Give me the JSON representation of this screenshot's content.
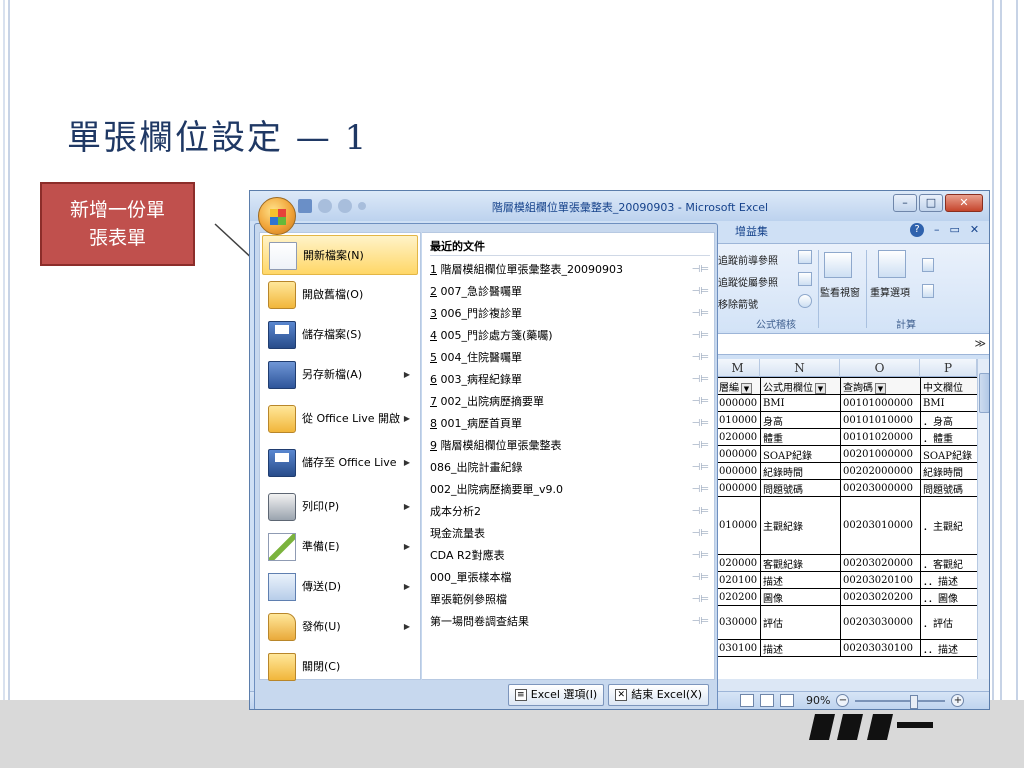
{
  "slide": {
    "title": "單張欄位設定 — 1",
    "callout": "新增一份單\n張表單"
  },
  "window": {
    "title": "階層模組欄位單張彙整表_20090903 - Microsoft Excel",
    "controls": [
      "minimize",
      "maximize",
      "close"
    ]
  },
  "ribbon": {
    "tab": "增益集",
    "help": "?",
    "items": [
      "追蹤前導參照",
      "追蹤從屬參照",
      "移除箭號",
      "監看視窗",
      "重算選項",
      "公式稽核",
      "計算"
    ]
  },
  "menu": {
    "commands": [
      {
        "label": "開新檔案(N)",
        "icon": "new-doc-icon",
        "has_sub": false,
        "highlight": true
      },
      {
        "label": "開啟舊檔(O)",
        "icon": "open-folder-icon",
        "has_sub": false
      },
      {
        "label": "儲存檔案(S)",
        "icon": "save-disk-icon",
        "has_sub": false
      },
      {
        "label": "另存新檔(A)",
        "icon": "save-as-icon",
        "has_sub": true
      },
      {
        "label": "從 Office Live 開啟",
        "icon": "open-live-icon",
        "has_sub": true
      },
      {
        "label": "儲存至 Office Live",
        "icon": "save-live-icon",
        "has_sub": true
      },
      {
        "label": "列印(P)",
        "icon": "printer-icon",
        "has_sub": true
      },
      {
        "label": "準備(E)",
        "icon": "prepare-icon",
        "has_sub": true
      },
      {
        "label": "傳送(D)",
        "icon": "send-icon",
        "has_sub": true
      },
      {
        "label": "發佈(U)",
        "icon": "publish-icon",
        "has_sub": true
      },
      {
        "label": "關閉(C)",
        "icon": "close-folder-icon",
        "has_sub": false
      }
    ],
    "recent_title": "最近的文件",
    "recent": [
      {
        "num": "1",
        "name": "階層模組欄位單張彙整表_20090903"
      },
      {
        "num": "2",
        "name": "007_急診醫囑單"
      },
      {
        "num": "3",
        "name": "006_門診複診單"
      },
      {
        "num": "4",
        "name": "005_門診處方箋(藥囑)"
      },
      {
        "num": "5",
        "name": "004_住院醫囑單"
      },
      {
        "num": "6",
        "name": "003_病程紀錄單"
      },
      {
        "num": "7",
        "name": "002_出院病歷摘要單"
      },
      {
        "num": "8",
        "name": "001_病歷首頁單"
      },
      {
        "num": "9",
        "name": "階層模組欄位單張彙整表"
      },
      {
        "num": "",
        "name": "086_出院計畫紀錄"
      },
      {
        "num": "",
        "name": "002_出院病歷摘要單_v9.0"
      },
      {
        "num": "",
        "name": "成本分析2"
      },
      {
        "num": "",
        "name": "現金流量表"
      },
      {
        "num": "",
        "name": "CDA R2對應表"
      },
      {
        "num": "",
        "name": "000_單張樣本檔"
      },
      {
        "num": "",
        "name": "單張範例參照檔"
      },
      {
        "num": "",
        "name": "第一場問卷調查結果"
      }
    ],
    "pin_glyph": "⊣⊨",
    "options_button": "Excel 選項(I)",
    "exit_button": "結束 Excel(X)"
  },
  "sheet": {
    "columns": [
      "M",
      "N",
      "O",
      "P"
    ],
    "header_row": [
      "層編",
      "公式用欄位",
      "查詢碼",
      "中文欄位"
    ],
    "rows": [
      {
        "m": "000000",
        "n": "BMI",
        "o": "00101000000",
        "p": "BMI",
        "kind": "normal"
      },
      {
        "m": "010000",
        "n": "身高",
        "o": "00101010000",
        "p": "．身高",
        "kind": "normal"
      },
      {
        "m": "020000",
        "n": "體重",
        "o": "00101020000",
        "p": "．體重",
        "kind": "normal"
      },
      {
        "m": "000000",
        "n": "SOAP紀錄",
        "o": "00201000000",
        "p": "SOAP紀錄",
        "kind": "normal"
      },
      {
        "m": "000000",
        "n": "紀錄時間",
        "o": "00202000000",
        "p": "紀錄時間",
        "kind": "normal"
      },
      {
        "m": "000000",
        "n": "問題號碼",
        "o": "00203000000",
        "p": "問題號碼",
        "kind": "normal"
      },
      {
        "m": "010000",
        "n": "主觀紀錄",
        "o": "00203010000",
        "p": "．主觀紀",
        "kind": "tall"
      },
      {
        "m": "020000",
        "n": "客觀紀錄",
        "o": "00203020000",
        "p": "．客觀紀",
        "kind": "normal"
      },
      {
        "m": "020100",
        "n": "描述",
        "o": "00203020100",
        "p": "．．描述",
        "kind": "normal"
      },
      {
        "m": "020200",
        "n": "圖像",
        "o": "00203020200",
        "p": "．．圖像",
        "kind": "normal"
      },
      {
        "m": "030000",
        "n": "評估",
        "o": "00203030000",
        "p": "．評估",
        "kind": "mid"
      },
      {
        "m": "030100",
        "n": "描述",
        "o": "00203030100",
        "p": "．．描述",
        "kind": "normal"
      }
    ]
  },
  "status": {
    "zoom": "90%"
  }
}
